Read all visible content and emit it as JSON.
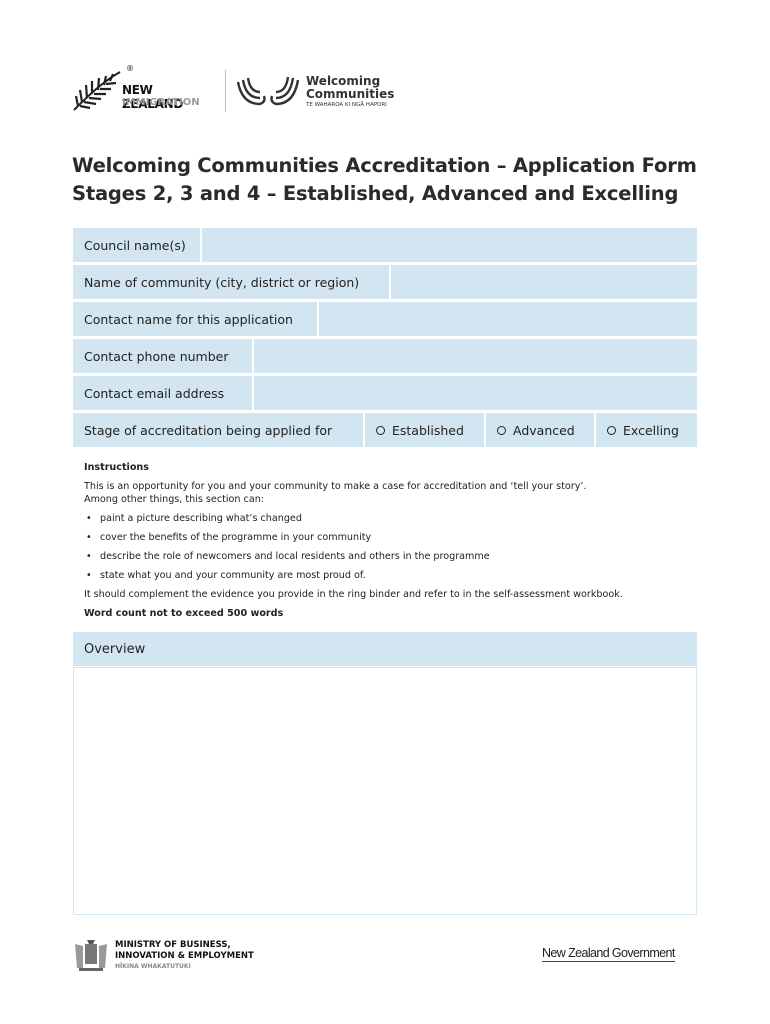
{
  "header": {
    "nzi_logo": {
      "line1": "NEW ZEALAND",
      "line2": "IMMIGRATION",
      "mark": "®"
    },
    "wc_logo": {
      "line1": "Welcoming",
      "line2": "Communities",
      "tagline": "TE WAHAROA KI NGĀ HAPORI"
    }
  },
  "title": {
    "line1": "Welcoming Communities Accreditation – Application Form",
    "line2": "Stages 2, 3 and 4 – Established, Advanced and Excelling"
  },
  "form": {
    "council": {
      "label": "Council name(s)",
      "value": ""
    },
    "community": {
      "label": "Name of community (city, district or region)",
      "value": ""
    },
    "contact_name": {
      "label": "Contact name for this application",
      "value": ""
    },
    "phone": {
      "label": "Contact phone number",
      "value": ""
    },
    "email": {
      "label": "Contact email address",
      "value": ""
    },
    "stage": {
      "label": "Stage of accreditation being applied for",
      "options": [
        "Established",
        "Advanced",
        "Excelling"
      ],
      "selected": null
    }
  },
  "instructions": {
    "heading": "Instructions",
    "intro1": "This is an opportunity for you and your community to make a case for accreditation and ‘tell your story’.",
    "intro2": "Among other things, this section can:",
    "bullets": [
      "paint a picture describing what’s changed",
      "cover the benefits of the programme in your community",
      "describe the role of newcomers and local residents and others in the programme",
      "state what you and your community are most proud of."
    ],
    "complement": "It should complement the evidence you provide in the ring binder and refer to in the self-assessment workbook.",
    "word_count": "Word count not to exceed 500 words"
  },
  "overview": {
    "label": "Overview",
    "value": ""
  },
  "footer": {
    "mbie": {
      "line1": "MINISTRY OF BUSINESS,",
      "line2": "INNOVATION & EMPLOYMENT",
      "line3": "HĪKINA WHAKATUTUKI"
    },
    "nzgov": "New Zealand Government"
  },
  "colors": {
    "field_bg": "#d3e5f0",
    "text": "#222222"
  }
}
